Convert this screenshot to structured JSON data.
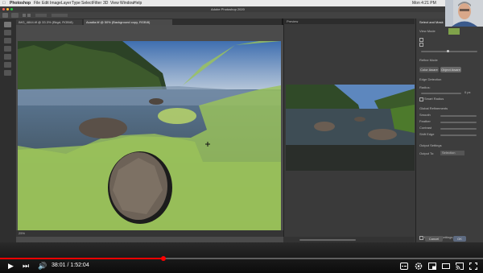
{
  "os": {
    "menu": [
      "Photoshop",
      "File",
      "Edit",
      "Image",
      "Layer",
      "Type",
      "Select",
      "Filter",
      "3D",
      "View",
      "Window",
      "Help"
    ],
    "status_right": "Mon 4:21 PM"
  },
  "app": {
    "window_title": "Adobe Photoshop 2020"
  },
  "tabs": [
    {
      "label": "IMG_4844.tif @ 33.3% (Bkgd, RGB/8)"
    },
    {
      "label": "Acadia.tif @ 50% (Background copy, RGB/8)"
    }
  ],
  "canvas": {
    "zoom": "25%"
  },
  "preview_panel": {
    "title": "Preview"
  },
  "properties": {
    "title": "Select and Mask",
    "view_mode_label": "View Mode",
    "refine_mode_label": "Refine Mode",
    "color_aware": "Color Aware",
    "object_aware": "Object Aware",
    "edge_detection": "Edge Detection",
    "radius_label": "Radius:",
    "radius_value": "0 px",
    "smart_radius": "Smart Radius",
    "global_refinements": "Global Refinements",
    "smooth_label": "Smooth",
    "feather_label": "Feather",
    "contrast_label": "Contrast",
    "shift_edge_label": "Shift Edge",
    "output_settings": "Output Settings",
    "output_to_label": "Output To:",
    "output_to_value": "Selection",
    "remember": "Remember Settings",
    "cancel": "Cancel",
    "ok": "OK"
  },
  "player": {
    "time_text": "38:01 / 1:52:04",
    "progress": 0.339
  },
  "colors": {
    "mask_overlay": "#9bc35a",
    "accent_red": "#ff0000"
  }
}
